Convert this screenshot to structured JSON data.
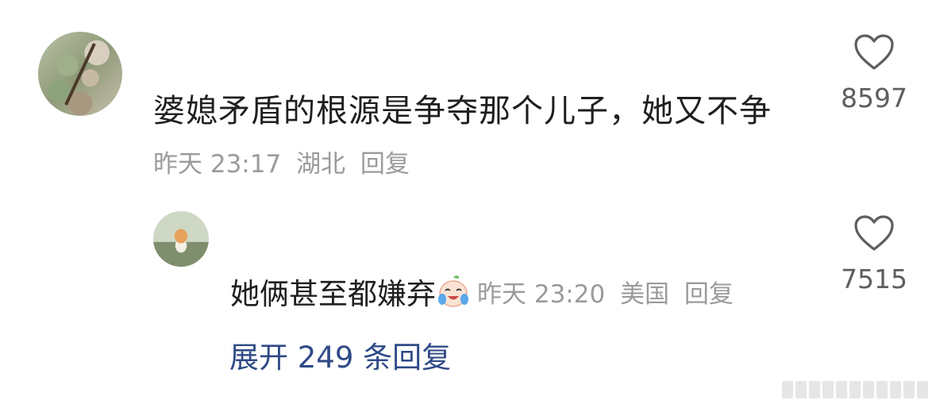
{
  "comment": {
    "text": "婆媳矛盾的根源是争夺那个儿子，她又不争",
    "time": "昨天 23:17",
    "location": "湖北",
    "reply_label": "回复",
    "likes": "8597"
  },
  "reply": {
    "text": "她俩甚至都嫌弃",
    "emoji": "crying-laughing-face-icon",
    "time": "昨天 23:20",
    "location": "美国",
    "reply_label": "回复",
    "likes": "7515"
  },
  "expand": {
    "label": "展开 249 条回复"
  },
  "colors": {
    "text": "#1f1f1f",
    "meta": "#9b9b9b",
    "link": "#2f4a86",
    "icon": "#5e5e5e"
  }
}
